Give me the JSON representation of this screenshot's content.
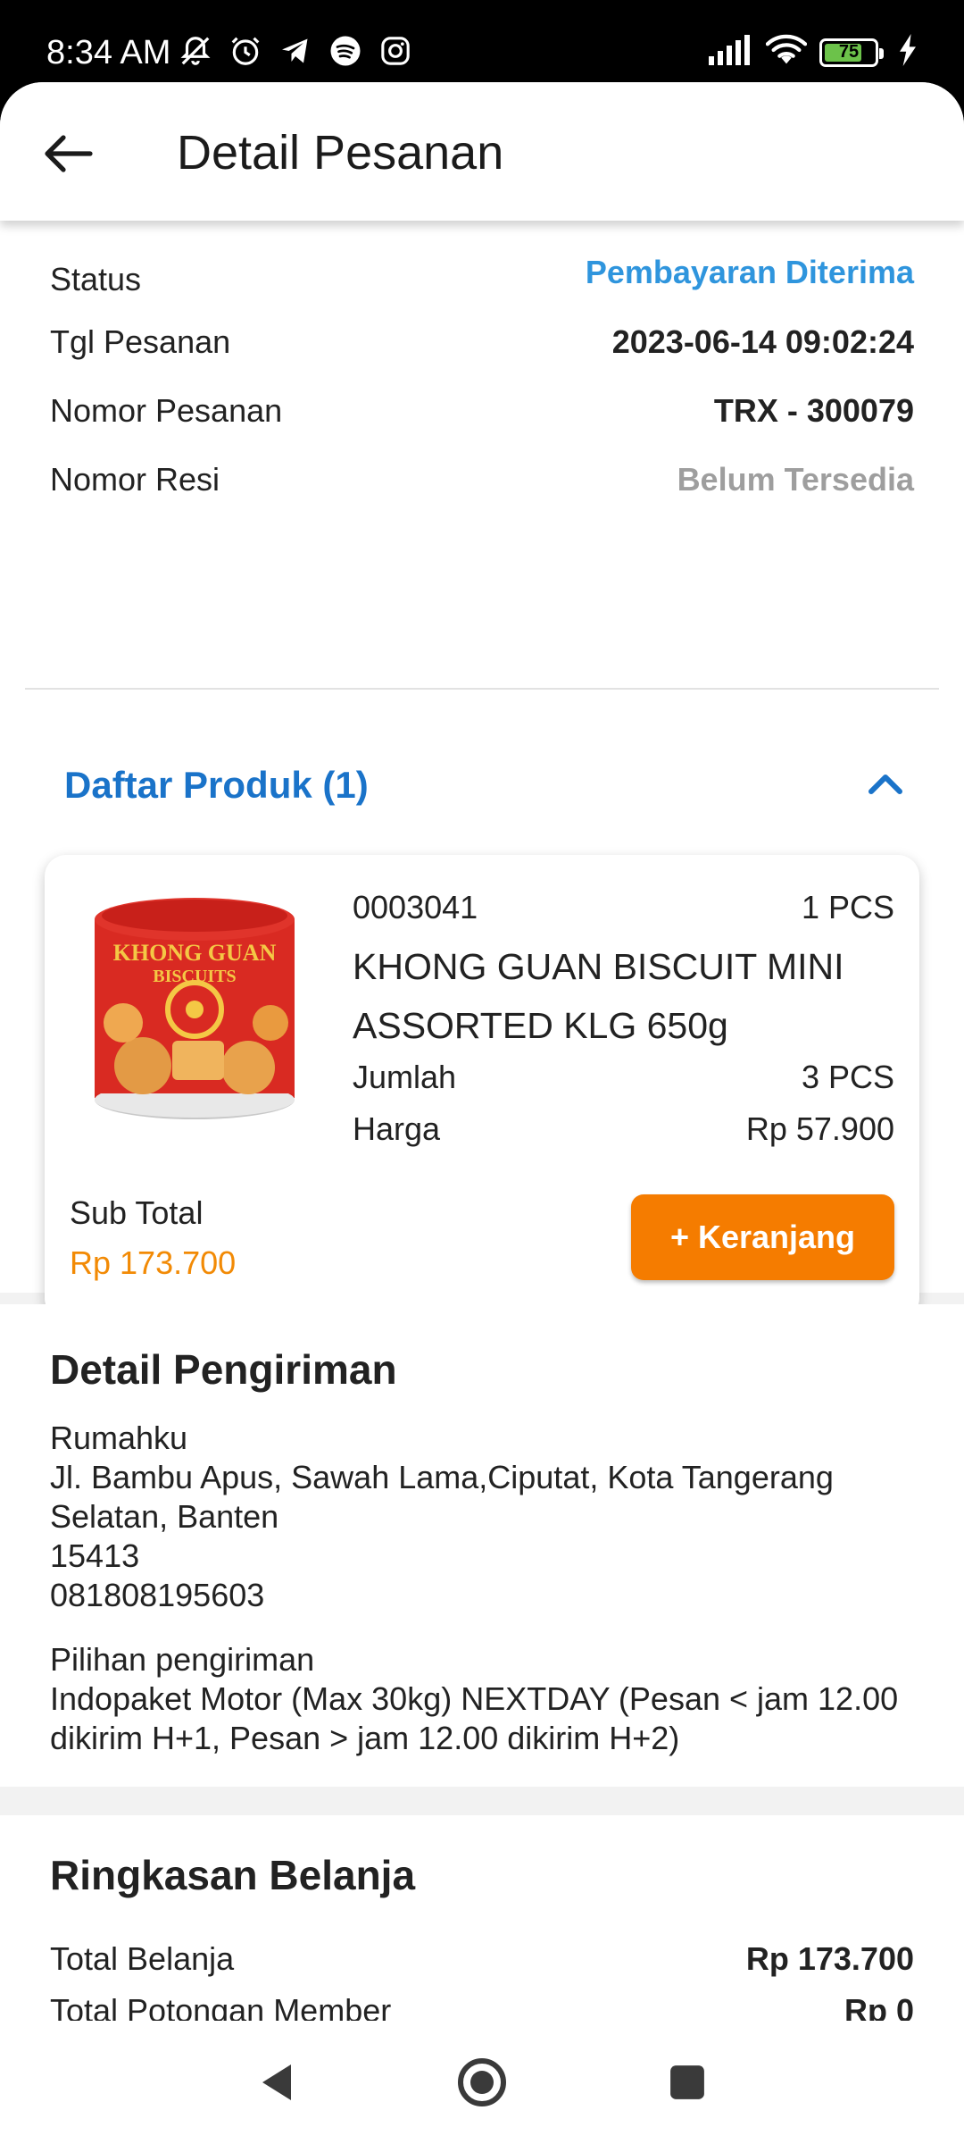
{
  "status_bar": {
    "time": "8:34 AM",
    "battery_level": "75",
    "battery_fraction": 0.75,
    "left_icons": [
      "notifications-muted-icon",
      "alarm-icon",
      "telegram-icon",
      "spotify-icon",
      "instagram-icon"
    ],
    "right_icons": [
      "signal-icon",
      "wifi-icon",
      "battery-icon",
      "charging-icon"
    ]
  },
  "header": {
    "title": "Detail Pesanan",
    "back_icon": "arrow-left-icon"
  },
  "order_info": {
    "status_label": "Status",
    "status_value": "Pembayaran Diterima",
    "date_label": "Tgl Pesanan",
    "date_value": "2023-06-14 09:02:24",
    "number_label": "Nomor Pesanan",
    "number_value": "TRX - 300079",
    "receipt_label": "Nomor Resi",
    "receipt_value": "Belum Tersedia"
  },
  "products": {
    "heading": "Daftar Produk (1)",
    "collapse_icon": "chevron-up-icon",
    "items": [
      {
        "code": "0003041",
        "unit_qty": "1 PCS",
        "name": "KHONG GUAN BISCUIT MINI ASSORTED  KLG 650g",
        "quantity_label": "Jumlah",
        "quantity_value": "3 PCS",
        "price_label": "Harga",
        "price_value": "Rp 57.900",
        "subtotal_label": "Sub Total",
        "subtotal_value": "Rp 173.700",
        "cart_button": "+ Keranjang",
        "image_brand_line1": "KHONG GUAN",
        "image_brand_line2": "BISCUITS"
      }
    ]
  },
  "shipping": {
    "title": "Detail Pengiriman",
    "address_name": "Rumahku",
    "address_line": "Jl. Bambu Apus, Sawah Lama,Ciputat, Kota Tangerang Selatan, Banten",
    "postal_code": "15413",
    "phone": "081808195603",
    "option_label": "Pilihan pengiriman",
    "option_value": "Indopaket Motor (Max 30kg) NEXTDAY  (Pesan < jam 12.00 dikirim H+1, Pesan > jam 12.00 dikirim H+2)"
  },
  "summary": {
    "title": "Ringkasan Belanja",
    "total_label": "Total Belanja",
    "total_value": "Rp 173.700",
    "discount_label": "Total Potongan Member",
    "discount_value": "Rp 0"
  },
  "nav": {
    "back_icon": "nav-back-icon",
    "home_icon": "nav-home-icon",
    "recents_icon": "nav-recents-icon"
  },
  "colors": {
    "status_blue": "#2f95dd",
    "heading_blue": "#1a73c9",
    "accent_orange": "#f57c00",
    "subtotal_orange": "#f28a05",
    "muted_grey": "#9e9e9e"
  }
}
